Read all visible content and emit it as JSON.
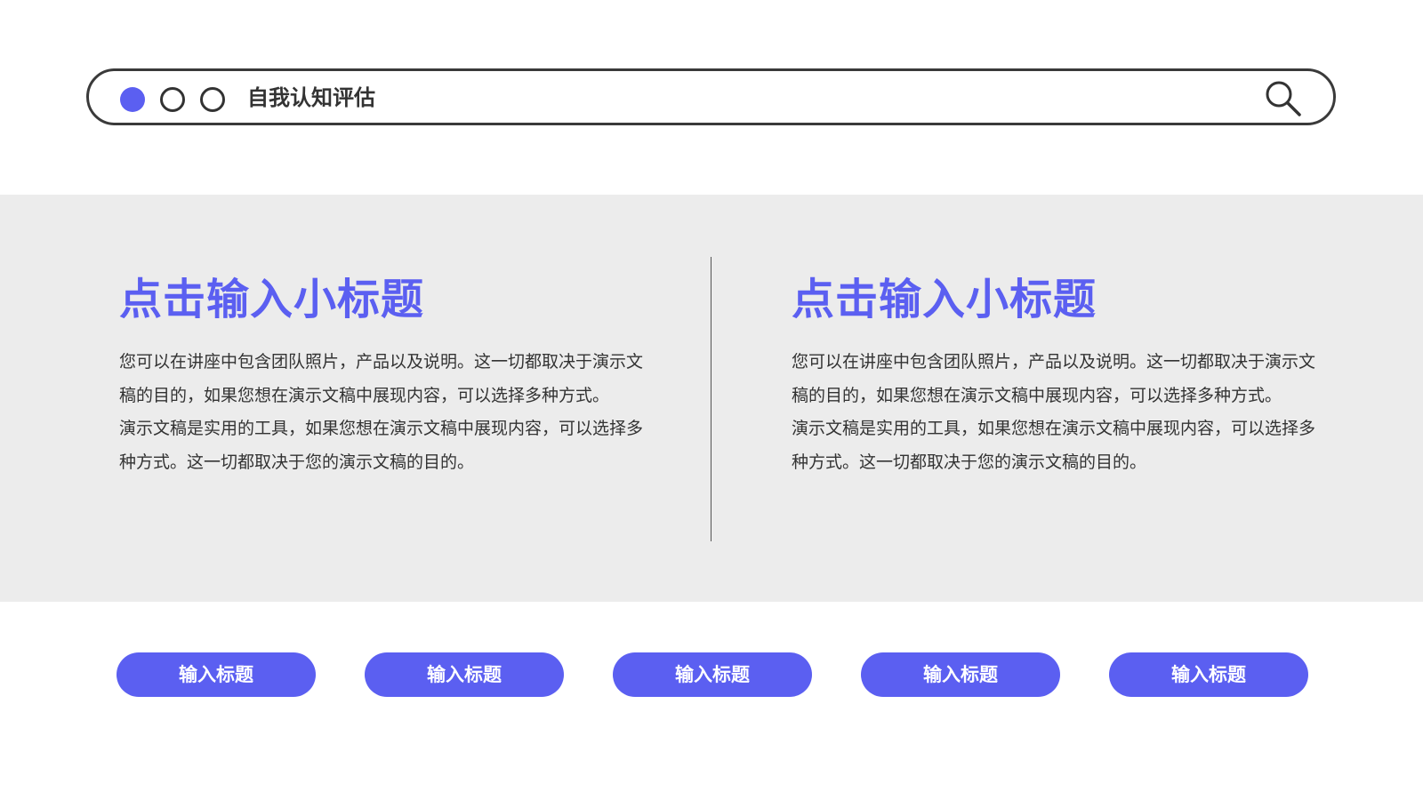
{
  "header": {
    "title": "自我认知评估",
    "icon": "search-icon",
    "dot_colors": [
      "#5b5ff1",
      "#333333",
      "#333333"
    ]
  },
  "colors": {
    "accent": "#5b5ff1",
    "band_background": "#ececec",
    "text": "#333333"
  },
  "columns": [
    {
      "subtitle": "点击输入小标题",
      "paragraph_1": "您可以在讲座中包含团队照片，产品以及说明。这一切都取决于演示文稿的目的，如果您想在演示文稿中展现内容，可以选择多种方式。",
      "paragraph_2": "演示文稿是实用的工具，如果您想在演示文稿中展现内容，可以选择多种方式。这一切都取决于您的演示文稿的目的。"
    },
    {
      "subtitle": "点击输入小标题",
      "paragraph_1": "您可以在讲座中包含团队照片，产品以及说明。这一切都取决于演示文稿的目的，如果您想在演示文稿中展现内容，可以选择多种方式。",
      "paragraph_2": "演示文稿是实用的工具，如果您想在演示文稿中展现内容，可以选择多种方式。这一切都取决于您的演示文稿的目的。"
    }
  ],
  "buttons": [
    {
      "label": "输入标题"
    },
    {
      "label": "输入标题"
    },
    {
      "label": "输入标题"
    },
    {
      "label": "输入标题"
    },
    {
      "label": "输入标题"
    }
  ]
}
